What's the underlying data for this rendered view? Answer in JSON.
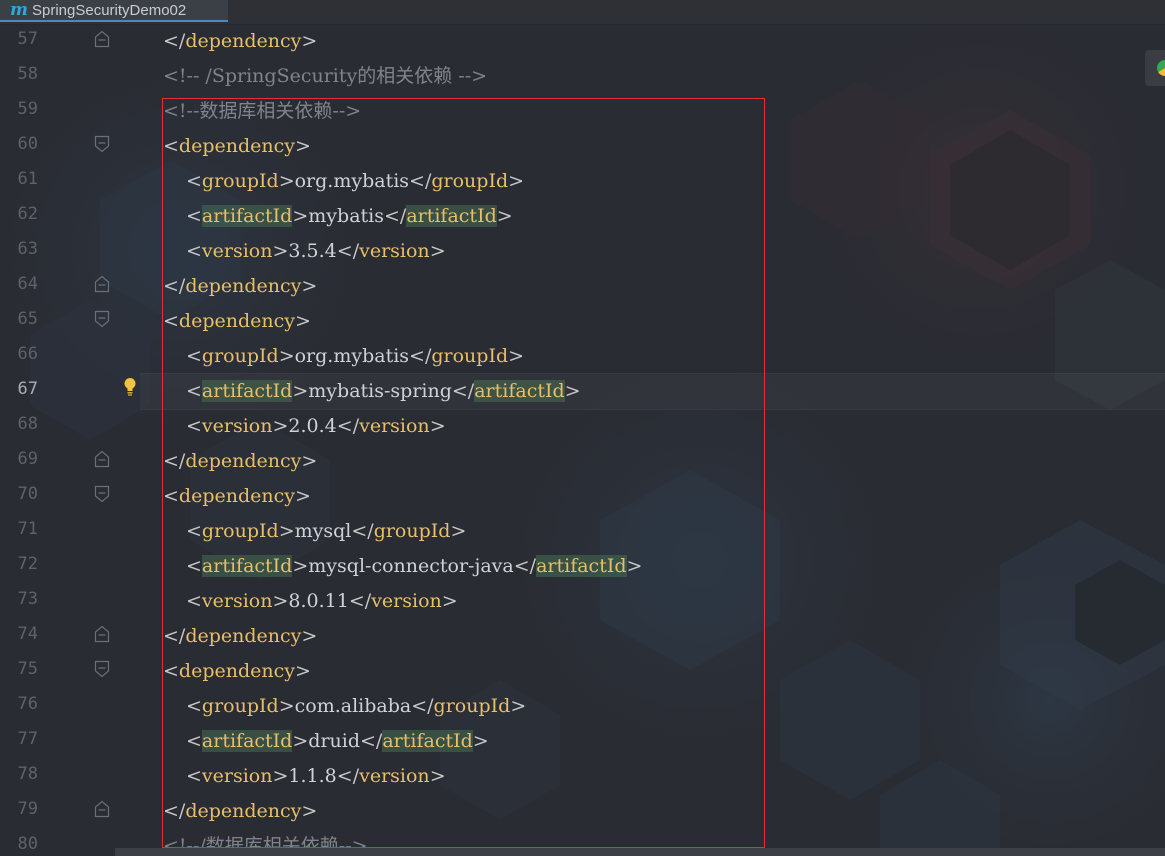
{
  "tab": {
    "icon": "m",
    "label": "SpringSecurityDemo02"
  },
  "editor": {
    "current_line": 67,
    "lines": [
      {
        "no": "57",
        "indent": 0,
        "fold": "end",
        "parts": [
          {
            "t": "</",
            "c": "br"
          },
          {
            "t": "dependency",
            "c": "tag"
          },
          {
            "t": ">",
            "c": "br"
          }
        ]
      },
      {
        "no": "58",
        "indent": 0,
        "fold": "",
        "parts": [
          {
            "t": "<!-- /SpringSecurity的相关依赖 -->",
            "c": "cmt"
          }
        ]
      },
      {
        "no": "59",
        "indent": 0,
        "fold": "",
        "parts": [
          {
            "t": "<!--数据库相关依赖-->",
            "c": "cmt"
          }
        ]
      },
      {
        "no": "60",
        "indent": 0,
        "fold": "start",
        "parts": [
          {
            "t": "<",
            "c": "br"
          },
          {
            "t": "dependency",
            "c": "tag"
          },
          {
            "t": ">",
            "c": "br"
          }
        ]
      },
      {
        "no": "61",
        "indent": 1,
        "fold": "",
        "parts": [
          {
            "t": "<",
            "c": "br"
          },
          {
            "t": "groupId",
            "c": "tag"
          },
          {
            "t": ">",
            "c": "br"
          },
          {
            "t": "org.mybatis",
            "c": "val"
          },
          {
            "t": "</",
            "c": "br"
          },
          {
            "t": "groupId",
            "c": "tag"
          },
          {
            "t": ">",
            "c": "br"
          }
        ]
      },
      {
        "no": "62",
        "indent": 1,
        "fold": "",
        "parts": [
          {
            "t": "<",
            "c": "br"
          },
          {
            "t": "artifactId",
            "c": "tag hl"
          },
          {
            "t": ">",
            "c": "br"
          },
          {
            "t": "mybatis",
            "c": "val"
          },
          {
            "t": "</",
            "c": "br"
          },
          {
            "t": "artifactId",
            "c": "tag hl"
          },
          {
            "t": ">",
            "c": "br"
          }
        ]
      },
      {
        "no": "63",
        "indent": 1,
        "fold": "",
        "parts": [
          {
            "t": "<",
            "c": "br"
          },
          {
            "t": "version",
            "c": "tag"
          },
          {
            "t": ">",
            "c": "br"
          },
          {
            "t": "3.5.4",
            "c": "val"
          },
          {
            "t": "</",
            "c": "br"
          },
          {
            "t": "version",
            "c": "tag"
          },
          {
            "t": ">",
            "c": "br"
          }
        ]
      },
      {
        "no": "64",
        "indent": 0,
        "fold": "end",
        "parts": [
          {
            "t": "</",
            "c": "br"
          },
          {
            "t": "dependency",
            "c": "tag"
          },
          {
            "t": ">",
            "c": "br"
          }
        ]
      },
      {
        "no": "65",
        "indent": 0,
        "fold": "start",
        "parts": [
          {
            "t": "<",
            "c": "br"
          },
          {
            "t": "dependency",
            "c": "tag"
          },
          {
            "t": ">",
            "c": "br"
          }
        ]
      },
      {
        "no": "66",
        "indent": 1,
        "fold": "",
        "parts": [
          {
            "t": "<",
            "c": "br"
          },
          {
            "t": "groupId",
            "c": "tag"
          },
          {
            "t": ">",
            "c": "br"
          },
          {
            "t": "org.mybatis",
            "c": "val"
          },
          {
            "t": "</",
            "c": "br"
          },
          {
            "t": "groupId",
            "c": "tag"
          },
          {
            "t": ">",
            "c": "br"
          }
        ]
      },
      {
        "no": "67",
        "indent": 1,
        "fold": "",
        "bulb": true,
        "parts": [
          {
            "t": "<",
            "c": "br hl"
          },
          {
            "t": "artifactId",
            "c": "tag hl"
          },
          {
            "t": ">",
            "c": "br hl"
          },
          {
            "t": "mybatis-spring",
            "c": "val"
          },
          {
            "t": "</",
            "c": "br hl"
          },
          {
            "t": "artifactId",
            "c": "tag hl"
          },
          {
            "t": ">",
            "c": "br hl"
          }
        ]
      },
      {
        "no": "68",
        "indent": 1,
        "fold": "",
        "parts": [
          {
            "t": "<",
            "c": "br"
          },
          {
            "t": "version",
            "c": "tag"
          },
          {
            "t": ">",
            "c": "br"
          },
          {
            "t": "2.0.4",
            "c": "val"
          },
          {
            "t": "</",
            "c": "br"
          },
          {
            "t": "version",
            "c": "tag"
          },
          {
            "t": ">",
            "c": "br"
          }
        ]
      },
      {
        "no": "69",
        "indent": 0,
        "fold": "end",
        "parts": [
          {
            "t": "</",
            "c": "br"
          },
          {
            "t": "dependency",
            "c": "tag"
          },
          {
            "t": ">",
            "c": "br"
          }
        ]
      },
      {
        "no": "70",
        "indent": 0,
        "fold": "start",
        "parts": [
          {
            "t": "<",
            "c": "br"
          },
          {
            "t": "dependency",
            "c": "tag"
          },
          {
            "t": ">",
            "c": "br"
          }
        ]
      },
      {
        "no": "71",
        "indent": 1,
        "fold": "",
        "parts": [
          {
            "t": "<",
            "c": "br"
          },
          {
            "t": "groupId",
            "c": "tag"
          },
          {
            "t": ">",
            "c": "br"
          },
          {
            "t": "mysql",
            "c": "val"
          },
          {
            "t": "</",
            "c": "br"
          },
          {
            "t": "groupId",
            "c": "tag"
          },
          {
            "t": ">",
            "c": "br"
          }
        ]
      },
      {
        "no": "72",
        "indent": 1,
        "fold": "",
        "parts": [
          {
            "t": "<",
            "c": "br"
          },
          {
            "t": "artifactId",
            "c": "tag hl"
          },
          {
            "t": ">",
            "c": "br"
          },
          {
            "t": "mysql-connector-java",
            "c": "val"
          },
          {
            "t": "</",
            "c": "br"
          },
          {
            "t": "artifactId",
            "c": "tag hl"
          },
          {
            "t": ">",
            "c": "br"
          }
        ]
      },
      {
        "no": "73",
        "indent": 1,
        "fold": "",
        "parts": [
          {
            "t": "<",
            "c": "br"
          },
          {
            "t": "version",
            "c": "tag"
          },
          {
            "t": ">",
            "c": "br"
          },
          {
            "t": "8.0.11",
            "c": "val"
          },
          {
            "t": "</",
            "c": "br"
          },
          {
            "t": "version",
            "c": "tag"
          },
          {
            "t": ">",
            "c": "br"
          }
        ]
      },
      {
        "no": "74",
        "indent": 0,
        "fold": "end",
        "parts": [
          {
            "t": "</",
            "c": "br"
          },
          {
            "t": "dependency",
            "c": "tag"
          },
          {
            "t": ">",
            "c": "br"
          }
        ]
      },
      {
        "no": "75",
        "indent": 0,
        "fold": "start",
        "parts": [
          {
            "t": "<",
            "c": "br"
          },
          {
            "t": "dependency",
            "c": "tag"
          },
          {
            "t": ">",
            "c": "br"
          }
        ]
      },
      {
        "no": "76",
        "indent": 1,
        "fold": "",
        "parts": [
          {
            "t": "<",
            "c": "br"
          },
          {
            "t": "groupId",
            "c": "tag"
          },
          {
            "t": ">",
            "c": "br"
          },
          {
            "t": "com.alibaba",
            "c": "val"
          },
          {
            "t": "</",
            "c": "br"
          },
          {
            "t": "groupId",
            "c": "tag"
          },
          {
            "t": ">",
            "c": "br"
          }
        ]
      },
      {
        "no": "77",
        "indent": 1,
        "fold": "",
        "parts": [
          {
            "t": "<",
            "c": "br"
          },
          {
            "t": "artifactId",
            "c": "tag hl"
          },
          {
            "t": ">",
            "c": "br"
          },
          {
            "t": "druid",
            "c": "val"
          },
          {
            "t": "</",
            "c": "br"
          },
          {
            "t": "artifactId",
            "c": "tag hl"
          },
          {
            "t": ">",
            "c": "br"
          }
        ]
      },
      {
        "no": "78",
        "indent": 1,
        "fold": "",
        "parts": [
          {
            "t": "<",
            "c": "br"
          },
          {
            "t": "version",
            "c": "tag"
          },
          {
            "t": ">",
            "c": "br"
          },
          {
            "t": "1.1.8",
            "c": "val"
          },
          {
            "t": "</",
            "c": "br"
          },
          {
            "t": "version",
            "c": "tag"
          },
          {
            "t": ">",
            "c": "br"
          }
        ]
      },
      {
        "no": "79",
        "indent": 0,
        "fold": "end",
        "parts": [
          {
            "t": "</",
            "c": "br"
          },
          {
            "t": "dependency",
            "c": "tag"
          },
          {
            "t": ">",
            "c": "br"
          }
        ]
      },
      {
        "no": "80",
        "indent": 0,
        "fold": "",
        "parts": [
          {
            "t": "<!--/数据库相关依赖-->",
            "c": "cmt"
          }
        ]
      }
    ]
  },
  "colors": {
    "background": "#2a2c33",
    "tag": "#e8bf6a",
    "comment": "#7f848c",
    "line_number": "#5d626b",
    "selection_box": "#e0303a"
  }
}
